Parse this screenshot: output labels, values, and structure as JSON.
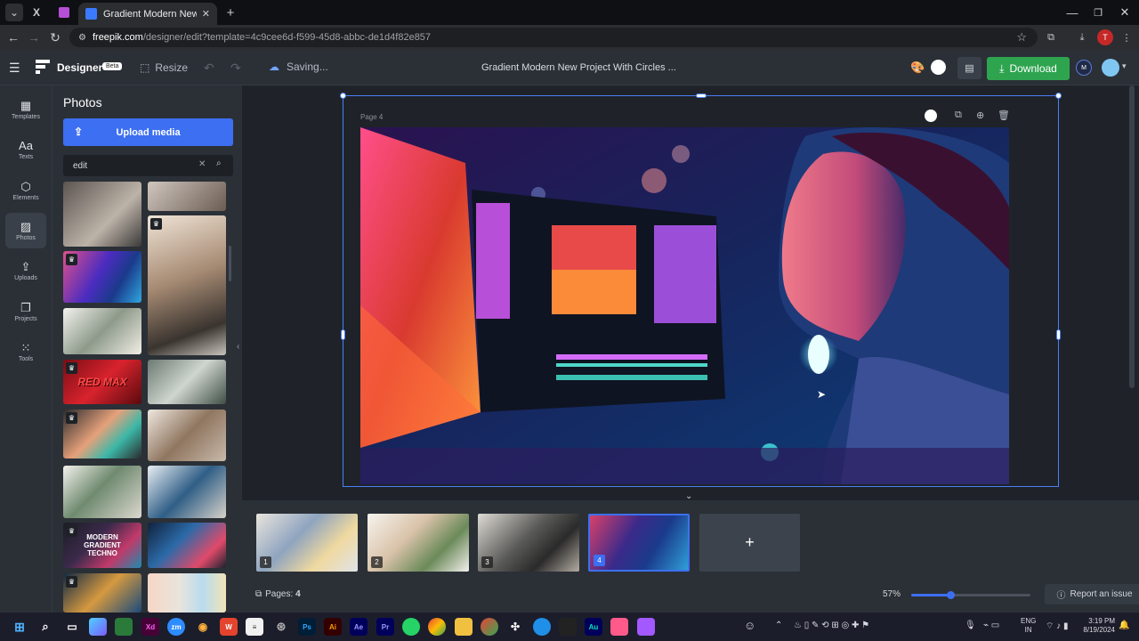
{
  "browser": {
    "tab_title": "Gradient Modern New Project W",
    "url_host": "freepik.com",
    "url_path": "/designer/edit?template=4c9cee6d-f599-45d8-abbc-de1d4f82e857",
    "profile_initial": "T"
  },
  "app": {
    "name": "Designer",
    "badge": "Beta",
    "resize_label": "Resize",
    "status": "Saving...",
    "doc_title": "Gradient Modern New Project With Circles ...",
    "download_label": "Download",
    "user_initials": "M"
  },
  "rail": [
    {
      "label": "Templates",
      "icon": "grid-icon"
    },
    {
      "label": "Texts",
      "icon": "text-icon"
    },
    {
      "label": "Elements",
      "icon": "shapes-icon"
    },
    {
      "label": "Photos",
      "icon": "photo-icon"
    },
    {
      "label": "Uploads",
      "icon": "upload-icon"
    },
    {
      "label": "Projects",
      "icon": "folder-icon"
    },
    {
      "label": "Tools",
      "icon": "apps-icon"
    }
  ],
  "panel": {
    "title": "Photos",
    "upload_label": "Upload media",
    "search_value": "edit",
    "thumb_text_1": "RED MAX",
    "thumb_text_2": "MODERN GRADIENT TECHNO"
  },
  "canvas": {
    "page_label": "Page 4"
  },
  "pages": {
    "items": [
      "1",
      "2",
      "3",
      "4"
    ],
    "active": 4,
    "count_label": "Pages:",
    "count_value": "4",
    "add_label": "+"
  },
  "zoom": {
    "label": "57%",
    "value": 0.57
  },
  "report_label": "Report an issue",
  "taskbar": {
    "lang_1": "ENG",
    "lang_2": "IN",
    "time": "3:19 PM",
    "date": "8/19/2024"
  },
  "colors": {
    "accent": "#3d6ff2",
    "download": "#2ea44f",
    "panel_bg": "#2b3037",
    "canvas_bg": "#1f2329"
  }
}
